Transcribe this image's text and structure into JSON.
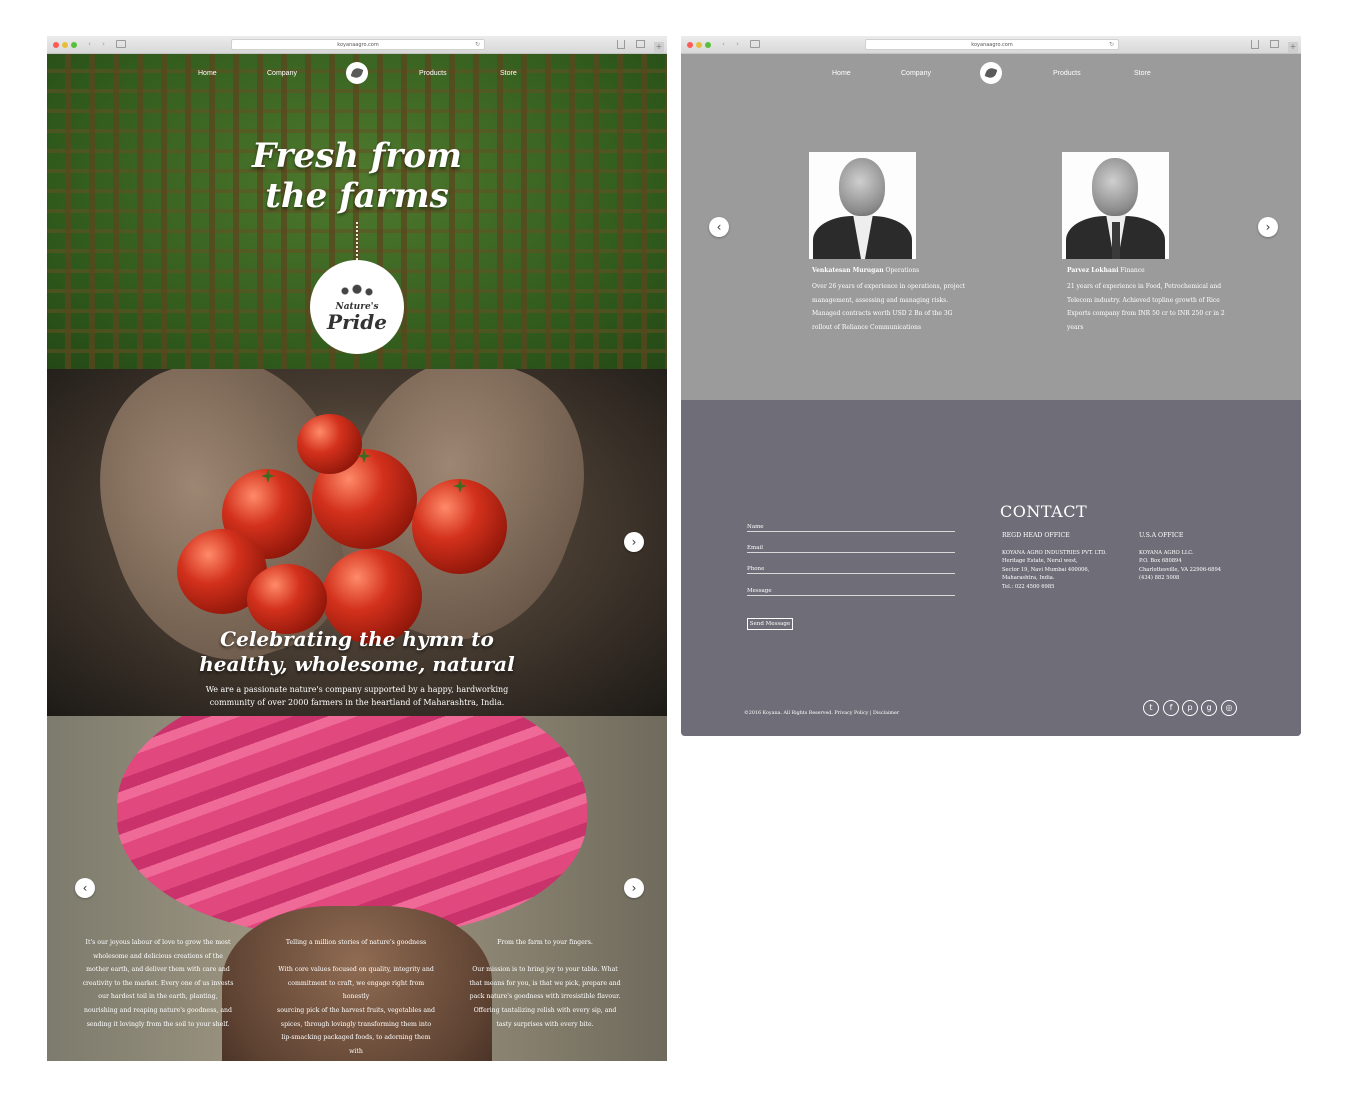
{
  "browser": {
    "url": "koyanaagro.com",
    "back": "‹",
    "forward": "›",
    "reload": "↻",
    "plus": "+"
  },
  "nav": {
    "home": "Home",
    "company": "Company",
    "products": "Products",
    "store": "Store",
    "home_right": "Home"
  },
  "hero": {
    "title_line1": "Fresh from",
    "title_line2": "the farms",
    "badge_line1": "Nature's",
    "badge_line2": "Pride"
  },
  "section2": {
    "title_line1": "Celebrating the hymn to",
    "title_line2": "healthy, wholesome, natural",
    "text_line1": "We are a passionate nature's company supported by a happy, hardworking",
    "text_line2": "community of over 2000 farmers in the heartland of Maharashtra, India."
  },
  "section3": {
    "col1": "It's our joyous labour of love to grow the most\nwholesome and delicious creations of the\nmother earth, and deliver them with  care and\ncreativity to the market. Every one of us invests\nour hardest toil in the earth, planting,\nnourishing and reaping nature's goodness, and\nsending it lovingly from the soil to your shelf.",
    "col2": "Telling a million stories of nature's goodness\n\nWith core values focused on quality, integrity and\ncommitment to craft, we engage right from honestly\nsourcing pick of the harvest fruits, vegetables and\nspices, through lovingly transforming them into\nlip-smacking packaged foods, to adorning them with\nrobust and safe packaging, and coming to your\nneighborhood store.",
    "col3": "From the farm to your fingers.\n\nOur mission is to bring joy to your table. What\nthat means for you, is that we pick, prepare and\npack nature's goodness with irresistible flavour.\nOffering tantalizing relish with every sip, and\ntasty surprises with every bite."
  },
  "team": [
    {
      "name": "Venkatesan Murugan",
      "role": "Operations",
      "bio": "Over 26 years of experience in operations, project management, assessing and managing risks. Managed contracts worth USD 2 Bn of the 3G rollout of Reliance Communications"
    },
    {
      "name": "Parvez Lokhani",
      "role": "Finance",
      "bio": "21 years of experience in Food, Petrochemical and Telecom industry. Achieved topline growth of Rice Exports company from INR 50 cr to INR 250 cr in 2 years"
    }
  ],
  "contact": {
    "title": "CONTACT",
    "fields": [
      "Name",
      "Email",
      "Phone",
      "Message"
    ],
    "send": "Send Message",
    "office1_title": "REGD HEAD OFFICE",
    "office1_addr": "KOYANA AGRO INDUSTRIES PVT. LTD.\nHeritage Estate, Nerul west,\nSector 19, Navi Mumbai 400006,\nMaharashtra, India.\nTel.: 022 4500 6985",
    "office2_title": "U.S.A OFFICE",
    "office2_addr": "KOYANA AGRO LLC.\nP.O. Box 680894\nCharlottesville, VA 22906-6894\n(434) 882 5008",
    "copyright": "©2016 Koyana. All Rights Reserved. Privacy Policy | Disclaimer"
  },
  "social": [
    "twitter-icon",
    "facebook-icon",
    "pinterest-icon",
    "google-plus-icon",
    "instagram-icon"
  ],
  "colors": {
    "accent_pink": "#e0487e",
    "team_bg": "#9b9b9b",
    "contact_bg": "#6f6e78"
  }
}
